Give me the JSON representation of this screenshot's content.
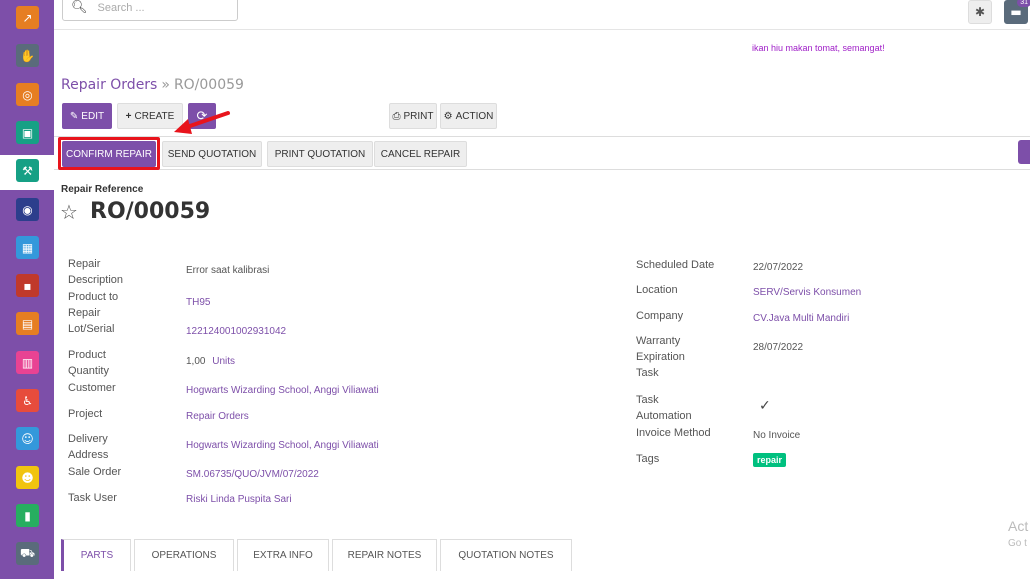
{
  "sidebar": {
    "apps": [
      {
        "icon": "chart-up-icon",
        "glyph": "↗",
        "color": "#e67e22"
      },
      {
        "icon": "handshake-icon",
        "glyph": "✋",
        "color": "#5a6b7b"
      },
      {
        "icon": "lifebuoy-icon",
        "glyph": "◎",
        "color": "#e67e22"
      },
      {
        "icon": "monitor-icon",
        "glyph": "▣",
        "color": "#16a085"
      },
      {
        "icon": "repair-icon",
        "glyph": "⚒",
        "color": "#16a085"
      },
      {
        "icon": "globe-icon",
        "glyph": "◉",
        "color": "#2c3e8c"
      },
      {
        "icon": "box-icon",
        "glyph": "▦",
        "color": "#3498db"
      },
      {
        "icon": "dot-square-icon",
        "glyph": "▪",
        "color": "#c0392b"
      },
      {
        "icon": "document-icon",
        "glyph": "▤",
        "color": "#e67e22"
      },
      {
        "icon": "inbox-icon",
        "glyph": "▥",
        "color": "#e84393"
      },
      {
        "icon": "accessibility-icon",
        "glyph": "♿",
        "color": "#e74c3c"
      },
      {
        "icon": "user-clock-icon",
        "glyph": "☺",
        "color": "#3498db"
      },
      {
        "icon": "users-gear-icon",
        "glyph": "☻",
        "color": "#f1c40f"
      },
      {
        "icon": "board-icon",
        "glyph": "▮",
        "color": "#27ae60"
      },
      {
        "icon": "car-icon",
        "glyph": "⛟",
        "color": "#5a6b7b"
      }
    ]
  },
  "topbar": {
    "search_placeholder": "Search ...",
    "bug_icon": "bug-icon",
    "chat_icon": "chat-icon",
    "chat_badge": "31"
  },
  "motto": "ikan hiu makan tomat, semangat!",
  "breadcrumb": {
    "parent": "Repair Orders",
    "separator": "»",
    "current": "RO/00059"
  },
  "controls": {
    "edit": "EDIT",
    "create": "CREATE",
    "print": "PRINT",
    "action": "ACTION"
  },
  "status_buttons": {
    "confirm": "CONFIRM REPAIR",
    "send_quotation": "SEND QUOTATION",
    "print_quotation": "PRINT QUOTATION",
    "cancel": "CANCEL REPAIR"
  },
  "form": {
    "ref_label": "Repair Reference",
    "name": "RO/00059",
    "left": {
      "description_label": "Repair Description",
      "description_value": "Error saat kalibrasi",
      "product_label": "Product to Repair",
      "product_value": "TH95",
      "lot_label": "Lot/Serial",
      "lot_value": "122124001002931042",
      "qty_label": "Product Quantity",
      "qty_value": "1,00",
      "qty_uom": "Units",
      "customer_label": "Customer",
      "customer_value": "Hogwarts Wizarding School, Anggi Viliawati",
      "project_label": "Project",
      "project_value": "Repair Orders",
      "delivery_label": "Delivery Address",
      "delivery_value": "Hogwarts Wizarding School, Anggi Viliawati",
      "sale_order_label": "Sale Order",
      "sale_order_value": "SM.06735/QUO/JVM/07/2022",
      "task_user_label": "Task User",
      "task_user_value": "Riski Linda Puspita Sari"
    },
    "right": {
      "scheduled_label": "Scheduled Date",
      "scheduled_value": "22/07/2022",
      "location_label": "Location",
      "location_value": "SERV/Servis Konsumen",
      "company_label": "Company",
      "company_value": "CV.Java Multi Mandiri",
      "warranty_label": "Warranty Expiration Task",
      "warranty_value": "28/07/2022",
      "automation_label": "Task Automation",
      "automation_value": "✓",
      "invoice_label": "Invoice Method",
      "invoice_value": "No Invoice",
      "tags_label": "Tags",
      "tag": "repair"
    }
  },
  "tabs": [
    "PARTS",
    "OPERATIONS",
    "EXTRA INFO",
    "REPAIR NOTES",
    "QUOTATION NOTES"
  ],
  "watermark": {
    "line1": "Act",
    "line2": "Go t"
  },
  "colors": {
    "brand": "#7d4fa9",
    "highlight": "#e8141c",
    "tag_green": "#00c07f"
  }
}
